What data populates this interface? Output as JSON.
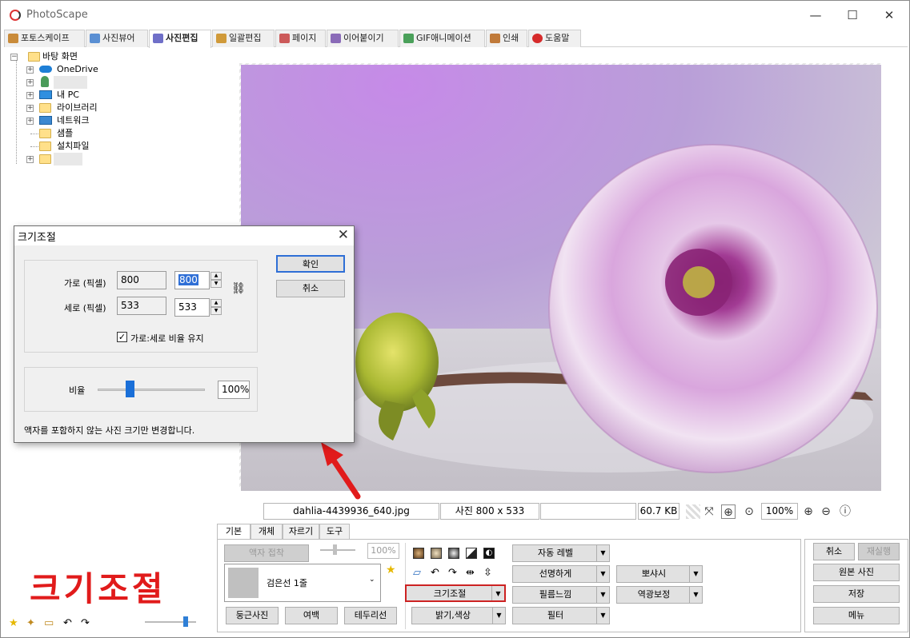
{
  "app": {
    "title": "PhotoScape"
  },
  "window_controls": {
    "minimize": "—",
    "maximize": "☐",
    "close": "✕"
  },
  "tabs": [
    {
      "label": "포토스케이프",
      "icon": "photoscape-icon",
      "color": "#c98b3a"
    },
    {
      "label": "사진뷰어",
      "icon": "viewer-icon",
      "color": "#5a8fd3"
    },
    {
      "label": "사진편집",
      "icon": "editor-icon",
      "color": "#6f6fc8",
      "active": true
    },
    {
      "label": "일괄편집",
      "icon": "batch-icon",
      "color": "#d09a3a"
    },
    {
      "label": "페이지",
      "icon": "page-icon",
      "color": "#cc5a5a"
    },
    {
      "label": "이어붙이기",
      "icon": "combine-icon",
      "color": "#8a6bb8"
    },
    {
      "label": "GIF애니메이션",
      "icon": "gif-icon",
      "color": "#4aa05a"
    },
    {
      "label": "인쇄",
      "icon": "print-icon",
      "color": "#c07a3a"
    },
    {
      "label": "도움말",
      "icon": "help-icon",
      "color": "#d62b2b"
    }
  ],
  "tree": {
    "root": "바탕 화면",
    "items": [
      "OneDrive",
      "",
      "내 PC",
      "라이브러리",
      "네트워크",
      "샘플",
      "설치파일",
      ""
    ]
  },
  "caption": "크기조절",
  "status": {
    "filename": "dahlia-4439936_640.jpg",
    "dimensions": "사진 800 x 533",
    "filesize": "60.7 KB",
    "zoom": "100%"
  },
  "bottom_tabs": [
    "기본",
    "개체",
    "자르기",
    "도구"
  ],
  "frame": {
    "apply_button": "액자 접착",
    "opacity": "100%",
    "frame_name": "검은선 1줄",
    "round_button": "둥근사진",
    "margin_button": "여백",
    "border_button": "테두리선"
  },
  "tools": {
    "resize": "크기조절",
    "brightness": "밝기,색상",
    "auto_level": "자동 레벨",
    "sharpen": "선명하게",
    "film": "필름느낌",
    "filter": "필터",
    "bloom": "뽀샤시",
    "backlight": "역광보정"
  },
  "right_buttons": {
    "cancel": "취소",
    "redo": "재실행",
    "original": "원본 사진",
    "save": "저장",
    "menu": "메뉴"
  },
  "dialog": {
    "title": "크기조절",
    "width_label": "가로 (픽셀)",
    "height_label": "세로 (픽셀)",
    "width_orig": "800",
    "width_new": "800",
    "height_orig": "533",
    "height_new": "533",
    "keep_ratio": "가로:세로 비율 유지",
    "ratio_label": "비율",
    "ratio_value": "100%",
    "ratio_level": 0.3,
    "ok": "확인",
    "cancel": "취소",
    "note": "액자를 포함하지 않는 사진 크기만 변경합니다."
  },
  "colors": {
    "accent_red": "#e11b1b",
    "highlight": "#cc2222"
  }
}
